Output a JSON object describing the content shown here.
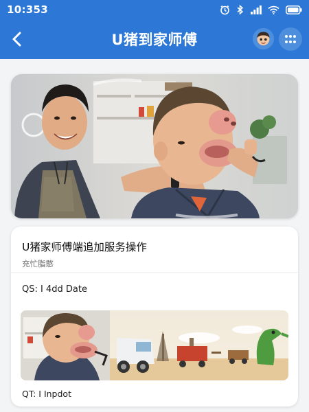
{
  "status_bar": {
    "time": "10:353",
    "icons": [
      "alarm-icon",
      "bluetooth-icon",
      "signal-icon",
      "wifi-icon",
      "battery-icon"
    ]
  },
  "app_bar": {
    "back_icon": "chevron-left-icon",
    "title": "U猪到家师傅",
    "avatar_icon": "avatar-icon",
    "menu_icon": "grid-dots-icon"
  },
  "hero": {
    "description": "photo"
  },
  "service_card": {
    "title": "U猪家师傅端追加服务操作",
    "subtitle": "充忙脂憨",
    "qs_line": "QS: I 4dd Date",
    "qt_line": "QT: I Inpdot"
  },
  "colors": {
    "primary": "#2d78d6",
    "background": "#f3f4f6",
    "card": "#ffffff"
  }
}
